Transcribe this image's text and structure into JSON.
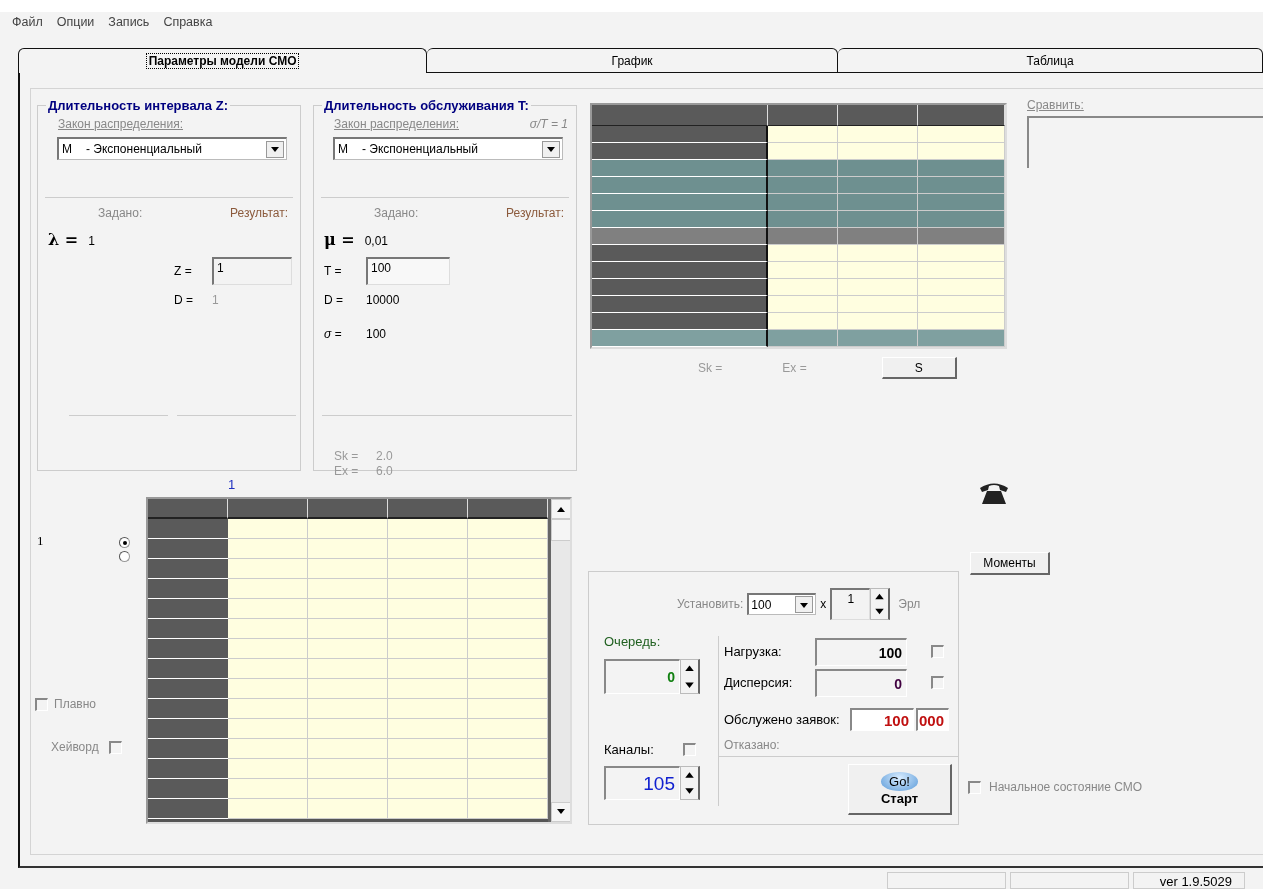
{
  "menu": [
    "Файл",
    "Опции",
    "Запись",
    "Справка"
  ],
  "tabs": [
    {
      "label": "Параметры модели СМО",
      "selected": true
    },
    {
      "label": "График",
      "selected": false
    },
    {
      "label": "Таблица",
      "selected": false
    }
  ],
  "interval_group": {
    "title": "Длительность интервала Z:",
    "law_label": "Закон распределения:",
    "law_code": "М",
    "law_name": "- Экспоненциальный",
    "given_label": "Задано:",
    "result_label": "Результат:",
    "rate_symbol": "λ =",
    "rate_value": "1",
    "z_label": "Z =",
    "z_value": "1",
    "d_label": "D =",
    "d_value": "1"
  },
  "service_group": {
    "title": "Длительность обслуживания T:",
    "law_label": "Закон распределения:",
    "ratio": "σ/T = 1",
    "law_code": "М",
    "law_name": "- Экспоненциальный",
    "given_label": "Задано:",
    "result_label": "Результат:",
    "rate_symbol": "μ =",
    "rate_value": "0,01",
    "t_label": "T =",
    "t_value": "100",
    "d_label": "D =",
    "d_value": "10000",
    "sigma_label": "σ =",
    "sigma_value": "100",
    "sk_label": "Sk =",
    "sk_value": "2.0",
    "ex_label": "Ex =",
    "ex_value": "6.0"
  },
  "mini_table": {
    "rows": [
      {
        "kind": "plain"
      },
      {
        "kind": "plain"
      },
      {
        "kind": "teal"
      },
      {
        "kind": "teal"
      },
      {
        "kind": "teal"
      },
      {
        "kind": "teal"
      },
      {
        "kind": "gray"
      },
      {
        "kind": "plain"
      },
      {
        "kind": "plain"
      },
      {
        "kind": "plain"
      },
      {
        "kind": "plain"
      },
      {
        "kind": "plain"
      },
      {
        "kind": "light-teal"
      }
    ],
    "sk_label": "Sk =",
    "ex_label": "Ex =",
    "button": "S"
  },
  "compare": {
    "label": "Сравнить:"
  },
  "lower": {
    "column_label": "1",
    "row_label": "1",
    "radios": [
      {
        "selected": true
      },
      {
        "selected": false
      }
    ],
    "smooth": {
      "label": "Плавно",
      "checked": false
    },
    "hayward": {
      "label": "Хейворд",
      "checked": false
    }
  },
  "moments_button": "Моменты",
  "control_panel": {
    "set_label": "Установить:",
    "set_value": "100",
    "times": "x",
    "multiplier": "1",
    "unit": "Эрл",
    "queue_label": "Очередь:",
    "queue_value": "0",
    "channels_label": "Каналы:",
    "channels_checked": false,
    "channels_value": "105",
    "load_label": "Нагрузка:",
    "load_value": "100",
    "load_checked": false,
    "dispersion_label": "Дисперсия:",
    "dispersion_value": "0",
    "dispersion_checked": false,
    "served_label": "Обслужено заявок:",
    "served_value": "100",
    "served_value_tail": "000",
    "refused_label": "Отказано:",
    "start_top": "Go!",
    "start_label": "Старт"
  },
  "initial_state": {
    "label": "Начальное состояние СМО",
    "checked": false
  },
  "status_bar": {
    "version": "ver 1.9.5029"
  }
}
